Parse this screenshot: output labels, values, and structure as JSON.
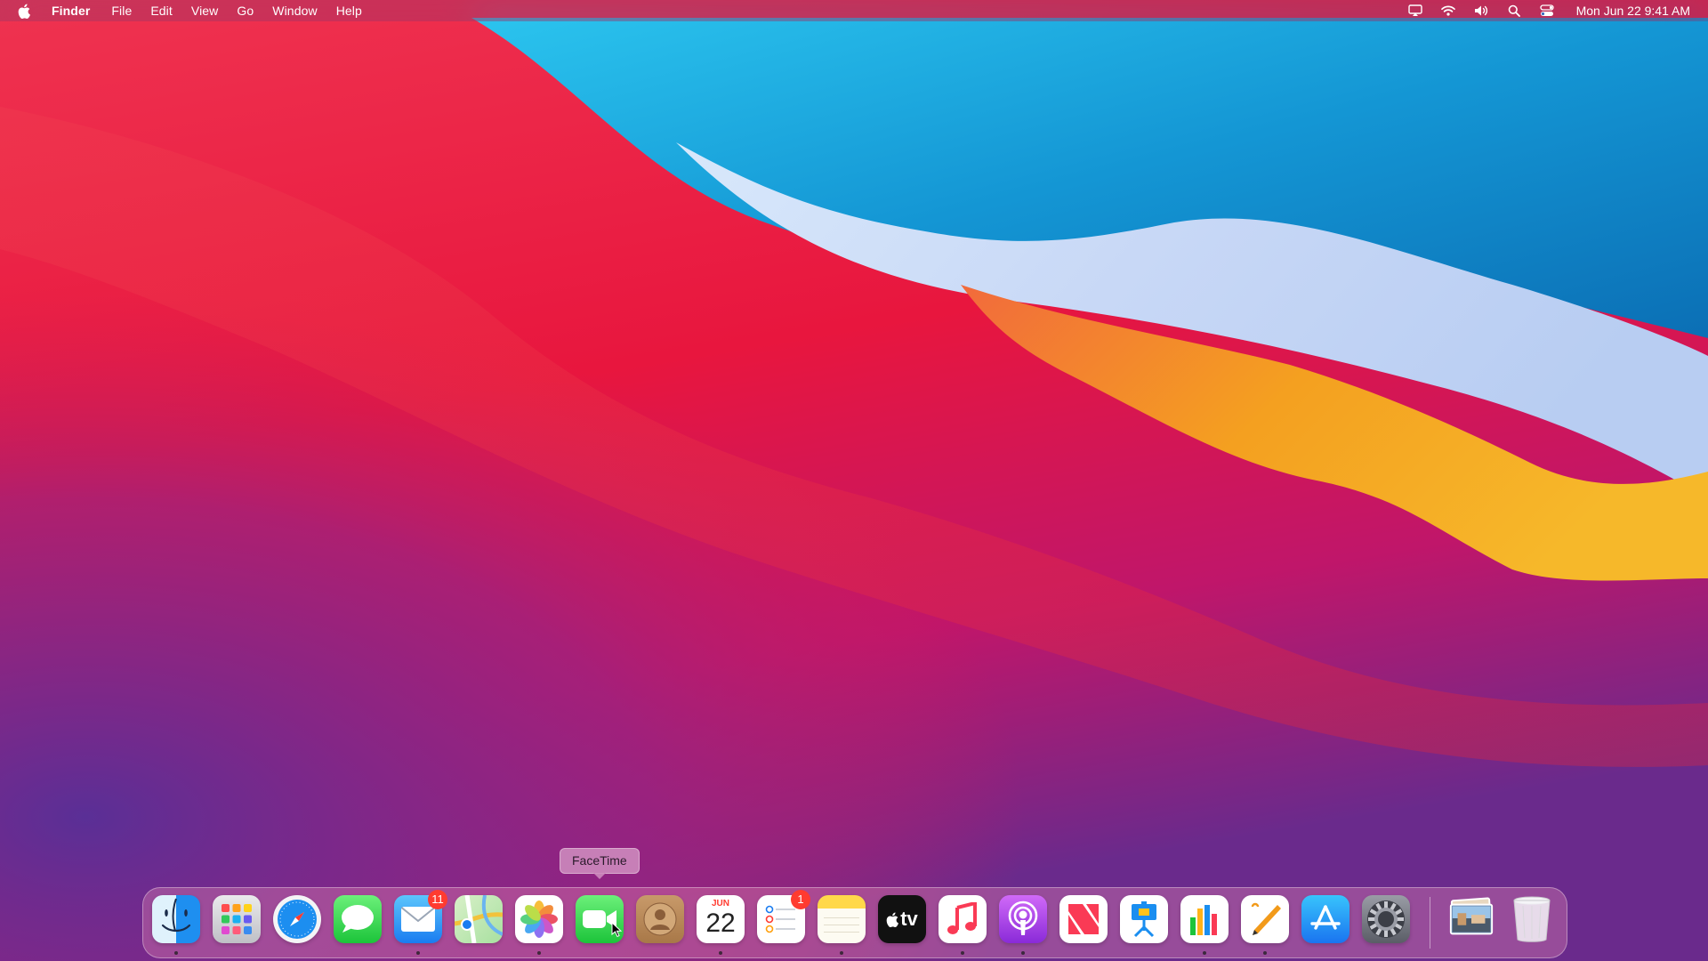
{
  "menubar": {
    "apple_icon": "apple-logo-icon",
    "app_name": "Finder",
    "menus": [
      "File",
      "Edit",
      "View",
      "Go",
      "Window",
      "Help"
    ],
    "status_icons": [
      "airplay-icon",
      "wifi-icon",
      "volume-icon",
      "spotlight-search-icon",
      "control-center-icon"
    ],
    "clock": "Mon Jun 22  9:41 AM"
  },
  "tooltip": {
    "text": "FaceTime"
  },
  "dock": {
    "apps": [
      {
        "name": "Finder",
        "icon": "finder-icon",
        "running": true
      },
      {
        "name": "Launchpad",
        "icon": "launchpad-icon",
        "running": false
      },
      {
        "name": "Safari",
        "icon": "safari-icon",
        "running": false
      },
      {
        "name": "Messages",
        "icon": "messages-icon",
        "running": false
      },
      {
        "name": "Mail",
        "icon": "mail-icon",
        "running": true,
        "badge": "11"
      },
      {
        "name": "Maps",
        "icon": "maps-icon",
        "running": false
      },
      {
        "name": "Photos",
        "icon": "photos-icon",
        "running": true
      },
      {
        "name": "FaceTime",
        "icon": "facetime-icon",
        "running": false
      },
      {
        "name": "Contacts",
        "icon": "contacts-icon",
        "running": false
      },
      {
        "name": "Calendar",
        "icon": "calendar-icon",
        "running": true,
        "month": "JUN",
        "day": "22"
      },
      {
        "name": "Reminders",
        "icon": "reminders-icon",
        "running": false,
        "badge": "1"
      },
      {
        "name": "Notes",
        "icon": "notes-icon",
        "running": true
      },
      {
        "name": "TV",
        "icon": "apple-tv-icon",
        "running": false,
        "label": "tv"
      },
      {
        "name": "Music",
        "icon": "music-icon",
        "running": true
      },
      {
        "name": "Podcasts",
        "icon": "podcasts-icon",
        "running": true
      },
      {
        "name": "News",
        "icon": "news-icon",
        "running": false
      },
      {
        "name": "Keynote",
        "icon": "keynote-icon",
        "running": false
      },
      {
        "name": "Numbers",
        "icon": "numbers-icon",
        "running": true
      },
      {
        "name": "Pages",
        "icon": "pages-icon",
        "running": true
      },
      {
        "name": "App Store",
        "icon": "app-store-icon",
        "running": false
      },
      {
        "name": "System Preferences",
        "icon": "system-preferences-icon",
        "running": false
      }
    ],
    "stack": {
      "name": "Downloads",
      "icon": "downloads-stack-icon"
    },
    "trash": {
      "name": "Trash",
      "icon": "trash-icon"
    }
  },
  "colors": {
    "wallpaper_red": "#e8253f",
    "wallpaper_blue": "#1a9fd8",
    "wallpaper_orange": "#f59a1c",
    "wallpaper_purple": "#7a2a8c",
    "badge": "#ff3b30"
  }
}
